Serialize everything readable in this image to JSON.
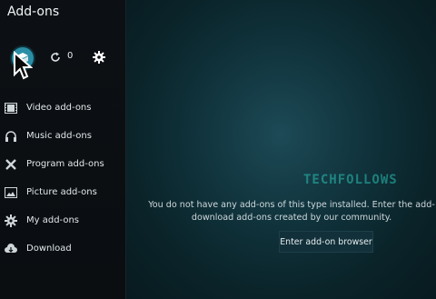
{
  "window": {
    "title": "Add-ons"
  },
  "toolbar": {
    "update_count": "0"
  },
  "sidebar": {
    "items": [
      {
        "label": "Video add-ons",
        "icon": "film-icon"
      },
      {
        "label": "Music add-ons",
        "icon": "headphones-icon"
      },
      {
        "label": "Program add-ons",
        "icon": "tools-icon"
      },
      {
        "label": "Picture add-ons",
        "icon": "picture-icon"
      },
      {
        "label": "My add-ons",
        "icon": "gear-box-icon"
      },
      {
        "label": "Download",
        "icon": "cloud-download-icon"
      }
    ]
  },
  "main": {
    "message_line1": "You do not have any add-ons of this type installed. Enter the add-",
    "message_line2": "download add-ons created by our community.",
    "browser_button": "Enter add-on browser",
    "watermark": "TECHFOLLOWS"
  },
  "colors": {
    "accent": "#2a8fa6",
    "background": "#07191f"
  }
}
